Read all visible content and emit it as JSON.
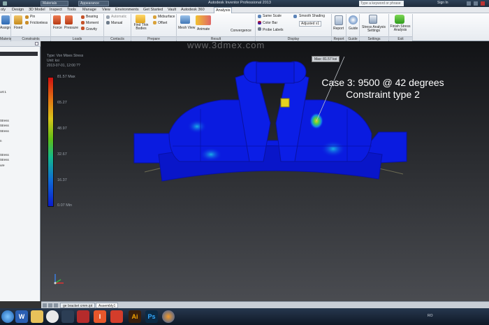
{
  "titlebar": {
    "project_dropdown": "Materials",
    "appearance_dropdown": "Appearance",
    "title": "Autodesk Inventor Professional 2013",
    "search_placeholder": "Type a keyword or phrase",
    "sign_in": "Sign In"
  },
  "menu_tabs": [
    "oly",
    "Design",
    "3D Model",
    "Inspect",
    "Tools",
    "Manage",
    "View",
    "Environments",
    "Get Started",
    "Vault",
    "Autodesk 360",
    "Analysis"
  ],
  "ribbon": {
    "assign": "Assign",
    "fixed": "Fixed",
    "pin": "Pin",
    "frictionless": "Frictionless",
    "force": "Force",
    "pressure": "Pressure",
    "bearing": "Bearing",
    "moment": "Moment",
    "gravity": "Gravity",
    "automatic": "Automatic",
    "manual": "Manual",
    "find_thin_bodies": "Find Thin Bodies",
    "midsurface": "Midsurface",
    "offset": "Offset",
    "mesh_view": "Mesh View",
    "animate": "Animate",
    "convergence": "Convergence",
    "same_scale": "Same Scale",
    "color_bar": "Color Bar",
    "probe_labels": "Probe Labels",
    "smooth_shading": "Smooth Shading",
    "adjusted": "Adjusted x1",
    "report": "Report",
    "guide": "Guide",
    "stress_analysis_settings": "Stress Analysis Settings",
    "finish_stress_analysis": "Finish Stress Analysis",
    "groups": [
      "Material",
      "Constraints",
      "Loads",
      "Contacts",
      "Prepare",
      "Result",
      "Display",
      "Report",
      "Guide",
      "Settings",
      "Exit"
    ]
  },
  "browser": {
    "items": [
      "ort:1",
      "Stress",
      "Stress",
      "Stress",
      "n",
      "Stress",
      "Stress",
      "ure"
    ]
  },
  "viewport": {
    "legend_type": "Type: Von Mises Stress",
    "legend_unit": "Unit: ksi",
    "legend_date": "2013-07-01, 12:00 ??",
    "legend_values": [
      "81.57 Max",
      "65.27",
      "48.97",
      "32.67",
      "16.37",
      "0.07 Min"
    ],
    "max_label": "Max: 81.57 ksi",
    "caption_line1": "Case 3: 9500 @ 42 degrees",
    "caption_line2": "Constraint type 2",
    "watermark": "www.3dmex.com"
  },
  "doc_tabs": [
    "ge bracket cmm.ipt",
    "Assembly1"
  ],
  "taskbar": {
    "icons": [
      "start",
      "word",
      "explorer",
      "chrome",
      "media",
      "paint",
      "inventor",
      "app",
      "illustrator",
      "photoshop",
      "firefox"
    ],
    "tray_label": "RO"
  },
  "colors": {
    "stress_max": "#d01010",
    "stress_mid": "#5fbf17",
    "stress_min": "#0b1ccc",
    "model_blue": "#0a1be0"
  }
}
